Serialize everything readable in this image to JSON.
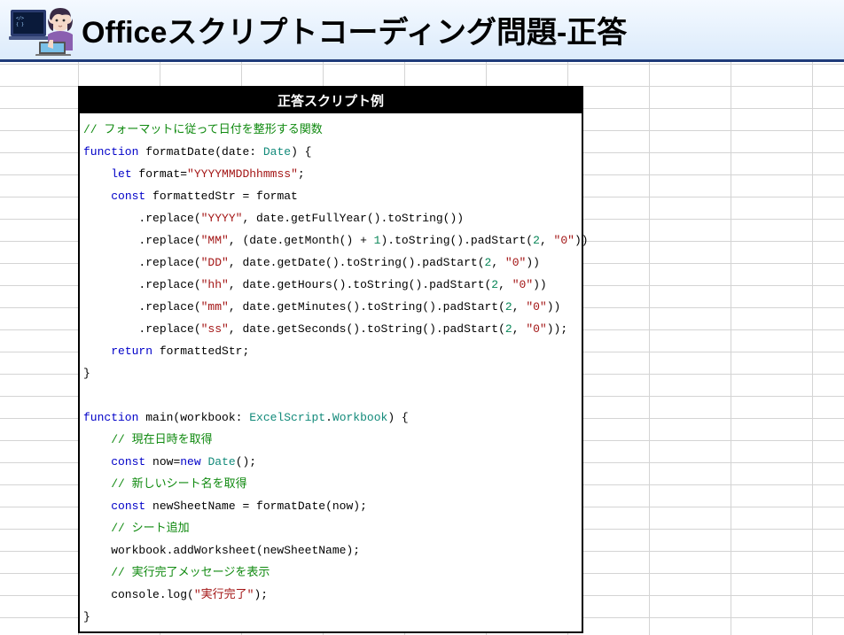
{
  "header": {
    "title": "Officeスクリプトコーディング問題-正答"
  },
  "panel": {
    "title": "正答スクリプト例"
  },
  "code": [
    [
      {
        "t": "// フォーマットに従って日付を整形する関数",
        "c": "c-comment"
      }
    ],
    [
      {
        "t": "function",
        "c": "c-kw"
      },
      {
        "t": " formatDate(date: ",
        "c": "c-plain"
      },
      {
        "t": "Date",
        "c": "c-type"
      },
      {
        "t": ") {",
        "c": "c-plain"
      }
    ],
    [
      {
        "t": "    ",
        "c": "c-plain"
      },
      {
        "t": "let",
        "c": "c-kw"
      },
      {
        "t": " format=",
        "c": "c-plain"
      },
      {
        "t": "\"YYYYMMDDhhmmss\"",
        "c": "c-str"
      },
      {
        "t": ";",
        "c": "c-plain"
      }
    ],
    [
      {
        "t": "    ",
        "c": "c-plain"
      },
      {
        "t": "const",
        "c": "c-kw"
      },
      {
        "t": " formattedStr = format",
        "c": "c-plain"
      }
    ],
    [
      {
        "t": "        .replace(",
        "c": "c-plain"
      },
      {
        "t": "\"YYYY\"",
        "c": "c-str"
      },
      {
        "t": ", date.getFullYear().toString())",
        "c": "c-plain"
      }
    ],
    [
      {
        "t": "        .replace(",
        "c": "c-plain"
      },
      {
        "t": "\"MM\"",
        "c": "c-str"
      },
      {
        "t": ", (date.getMonth() + ",
        "c": "c-plain"
      },
      {
        "t": "1",
        "c": "c-num"
      },
      {
        "t": ").toString().padStart(",
        "c": "c-plain"
      },
      {
        "t": "2",
        "c": "c-num"
      },
      {
        "t": ", ",
        "c": "c-plain"
      },
      {
        "t": "\"0\"",
        "c": "c-str"
      },
      {
        "t": "))",
        "c": "c-plain"
      }
    ],
    [
      {
        "t": "        .replace(",
        "c": "c-plain"
      },
      {
        "t": "\"DD\"",
        "c": "c-str"
      },
      {
        "t": ", date.getDate().toString().padStart(",
        "c": "c-plain"
      },
      {
        "t": "2",
        "c": "c-num"
      },
      {
        "t": ", ",
        "c": "c-plain"
      },
      {
        "t": "\"0\"",
        "c": "c-str"
      },
      {
        "t": "))",
        "c": "c-plain"
      }
    ],
    [
      {
        "t": "        .replace(",
        "c": "c-plain"
      },
      {
        "t": "\"hh\"",
        "c": "c-str"
      },
      {
        "t": ", date.getHours().toString().padStart(",
        "c": "c-plain"
      },
      {
        "t": "2",
        "c": "c-num"
      },
      {
        "t": ", ",
        "c": "c-plain"
      },
      {
        "t": "\"0\"",
        "c": "c-str"
      },
      {
        "t": "))",
        "c": "c-plain"
      }
    ],
    [
      {
        "t": "        .replace(",
        "c": "c-plain"
      },
      {
        "t": "\"mm\"",
        "c": "c-str"
      },
      {
        "t": ", date.getMinutes().toString().padStart(",
        "c": "c-plain"
      },
      {
        "t": "2",
        "c": "c-num"
      },
      {
        "t": ", ",
        "c": "c-plain"
      },
      {
        "t": "\"0\"",
        "c": "c-str"
      },
      {
        "t": "))",
        "c": "c-plain"
      }
    ],
    [
      {
        "t": "        .replace(",
        "c": "c-plain"
      },
      {
        "t": "\"ss\"",
        "c": "c-str"
      },
      {
        "t": ", date.getSeconds().toString().padStart(",
        "c": "c-plain"
      },
      {
        "t": "2",
        "c": "c-num"
      },
      {
        "t": ", ",
        "c": "c-plain"
      },
      {
        "t": "\"0\"",
        "c": "c-str"
      },
      {
        "t": "));",
        "c": "c-plain"
      }
    ],
    [
      {
        "t": "    ",
        "c": "c-plain"
      },
      {
        "t": "return",
        "c": "c-kw"
      },
      {
        "t": " formattedStr;",
        "c": "c-plain"
      }
    ],
    [
      {
        "t": "}",
        "c": "c-plain"
      }
    ],
    [
      {
        "t": " ",
        "c": "c-plain"
      }
    ],
    [
      {
        "t": "function",
        "c": "c-kw"
      },
      {
        "t": " main(workbook: ",
        "c": "c-plain"
      },
      {
        "t": "ExcelScript",
        "c": "c-type"
      },
      {
        "t": ".",
        "c": "c-plain"
      },
      {
        "t": "Workbook",
        "c": "c-type"
      },
      {
        "t": ") {",
        "c": "c-plain"
      }
    ],
    [
      {
        "t": "    ",
        "c": "c-plain"
      },
      {
        "t": "// 現在日時を取得",
        "c": "c-comment"
      }
    ],
    [
      {
        "t": "    ",
        "c": "c-plain"
      },
      {
        "t": "const",
        "c": "c-kw"
      },
      {
        "t": " now=",
        "c": "c-plain"
      },
      {
        "t": "new",
        "c": "c-kw"
      },
      {
        "t": " ",
        "c": "c-plain"
      },
      {
        "t": "Date",
        "c": "c-type"
      },
      {
        "t": "();",
        "c": "c-plain"
      }
    ],
    [
      {
        "t": "    ",
        "c": "c-plain"
      },
      {
        "t": "// 新しいシート名を取得",
        "c": "c-comment"
      }
    ],
    [
      {
        "t": "    ",
        "c": "c-plain"
      },
      {
        "t": "const",
        "c": "c-kw"
      },
      {
        "t": " newSheetName = formatDate(now);",
        "c": "c-plain"
      }
    ],
    [
      {
        "t": "    ",
        "c": "c-plain"
      },
      {
        "t": "// シート追加",
        "c": "c-comment"
      }
    ],
    [
      {
        "t": "    workbook.addWorksheet(newSheetName);",
        "c": "c-plain"
      }
    ],
    [
      {
        "t": "    ",
        "c": "c-plain"
      },
      {
        "t": "// 実行完了メッセージを表示",
        "c": "c-comment"
      }
    ],
    [
      {
        "t": "    console.log(",
        "c": "c-plain"
      },
      {
        "t": "\"実行完了\"",
        "c": "c-str"
      },
      {
        "t": ");",
        "c": "c-plain"
      }
    ],
    [
      {
        "t": "}",
        "c": "c-plain"
      }
    ]
  ]
}
